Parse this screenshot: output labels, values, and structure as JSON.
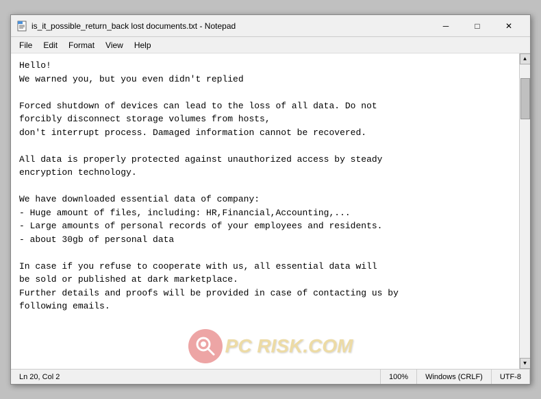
{
  "window": {
    "title": "is_it_possible_return_back lost documents.txt - Notepad",
    "icon": "notepad"
  },
  "titlebar": {
    "minimize_label": "─",
    "maximize_label": "□",
    "close_label": "✕"
  },
  "menubar": {
    "items": [
      {
        "label": "File"
      },
      {
        "label": "Edit"
      },
      {
        "label": "Format"
      },
      {
        "label": "View"
      },
      {
        "label": "Help"
      }
    ]
  },
  "content": {
    "text": "Hello!\nWe warned you, but you even didn't replied\n\nForced shutdown of devices can lead to the loss of all data. Do not\nforcibly disconnect storage volumes from hosts,\ndon't interrupt process. Damaged information cannot be recovered.\n\nAll data is properly protected against unauthorized access by steady\nencryption technology.\n\nWe have downloaded essential data of company:\n- Huge amount of files, including: HR,Financial,Accounting,...\n- Large amounts of personal records of your employees and residents.\n- about 30gb of personal data\n\nIn case if you refuse to cooperate with us, all essential data will\nbe sold or published at dark marketplace.\nFurther details and proofs will be provided in case of contacting us by\nfollowing emails."
  },
  "statusbar": {
    "position": "Ln 20, Col 2",
    "zoom": "100%",
    "line_ending": "Windows (CRLF)",
    "encoding": "UTF-8"
  },
  "watermark": {
    "text": "PC RISK.COM"
  }
}
